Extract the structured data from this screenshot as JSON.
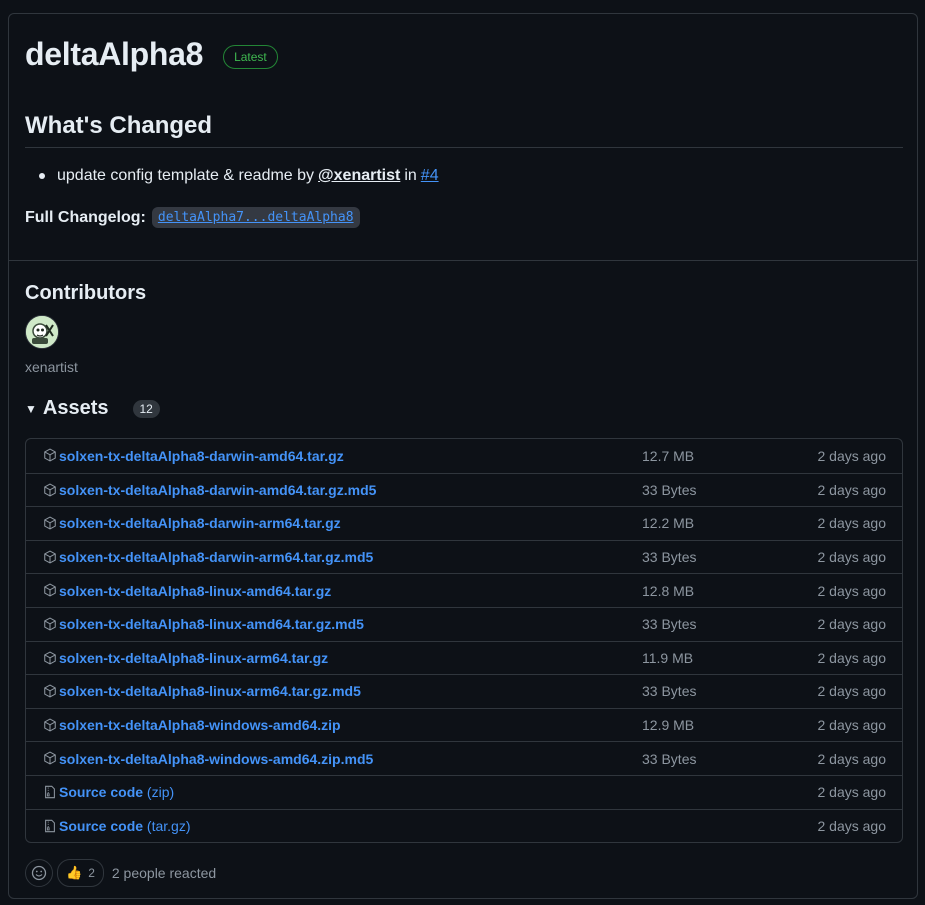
{
  "release": {
    "title": "deltaAlpha8",
    "badge": "Latest"
  },
  "notes": {
    "heading": "What's Changed",
    "item_text": "update config template & readme by",
    "mention": "@xenartist",
    "in_text": "in",
    "pr_link": "#4",
    "full_changelog_label": "Full Changelog:",
    "changelog_link": "deltaAlpha7...deltaAlpha8"
  },
  "contributors": {
    "heading": "Contributors",
    "users": [
      "xenartist"
    ]
  },
  "assets": {
    "heading": "Assets",
    "count": "12",
    "rows": [
      {
        "name": "solxen-tx-deltaAlpha8-darwin-amd64.tar.gz",
        "ext": "",
        "size": "12.7 MB",
        "date": "2 days ago",
        "icon": "package-icon"
      },
      {
        "name": "solxen-tx-deltaAlpha8-darwin-amd64.tar.gz.md5",
        "ext": "",
        "size": "33 Bytes",
        "date": "2 days ago",
        "icon": "package-icon"
      },
      {
        "name": "solxen-tx-deltaAlpha8-darwin-arm64.tar.gz",
        "ext": "",
        "size": "12.2 MB",
        "date": "2 days ago",
        "icon": "package-icon"
      },
      {
        "name": "solxen-tx-deltaAlpha8-darwin-arm64.tar.gz.md5",
        "ext": "",
        "size": "33 Bytes",
        "date": "2 days ago",
        "icon": "package-icon"
      },
      {
        "name": "solxen-tx-deltaAlpha8-linux-amd64.tar.gz",
        "ext": "",
        "size": "12.8 MB",
        "date": "2 days ago",
        "icon": "package-icon"
      },
      {
        "name": "solxen-tx-deltaAlpha8-linux-amd64.tar.gz.md5",
        "ext": "",
        "size": "33 Bytes",
        "date": "2 days ago",
        "icon": "package-icon"
      },
      {
        "name": "solxen-tx-deltaAlpha8-linux-arm64.tar.gz",
        "ext": "",
        "size": "11.9 MB",
        "date": "2 days ago",
        "icon": "package-icon"
      },
      {
        "name": "solxen-tx-deltaAlpha8-linux-arm64.tar.gz.md5",
        "ext": "",
        "size": "33 Bytes",
        "date": "2 days ago",
        "icon": "package-icon"
      },
      {
        "name": "solxen-tx-deltaAlpha8-windows-amd64.zip",
        "ext": "",
        "size": "12.9 MB",
        "date": "2 days ago",
        "icon": "package-icon"
      },
      {
        "name": "solxen-tx-deltaAlpha8-windows-amd64.zip.md5",
        "ext": "",
        "size": "33 Bytes",
        "date": "2 days ago",
        "icon": "package-icon"
      },
      {
        "name": "Source code",
        "ext": "(zip)",
        "size": "",
        "date": "2 days ago",
        "icon": "file-zip-icon"
      },
      {
        "name": "Source code",
        "ext": "(tar.gz)",
        "size": "",
        "date": "2 days ago",
        "icon": "file-zip-icon"
      }
    ]
  },
  "reactions": {
    "thumbs_count": "2",
    "summary": "2 people reacted",
    "emoji": "👍"
  },
  "colors": {
    "background": "#0d1117",
    "border": "#30363d",
    "link": "#4493f8",
    "muted": "#8d96a0",
    "success": "#3fb950"
  }
}
